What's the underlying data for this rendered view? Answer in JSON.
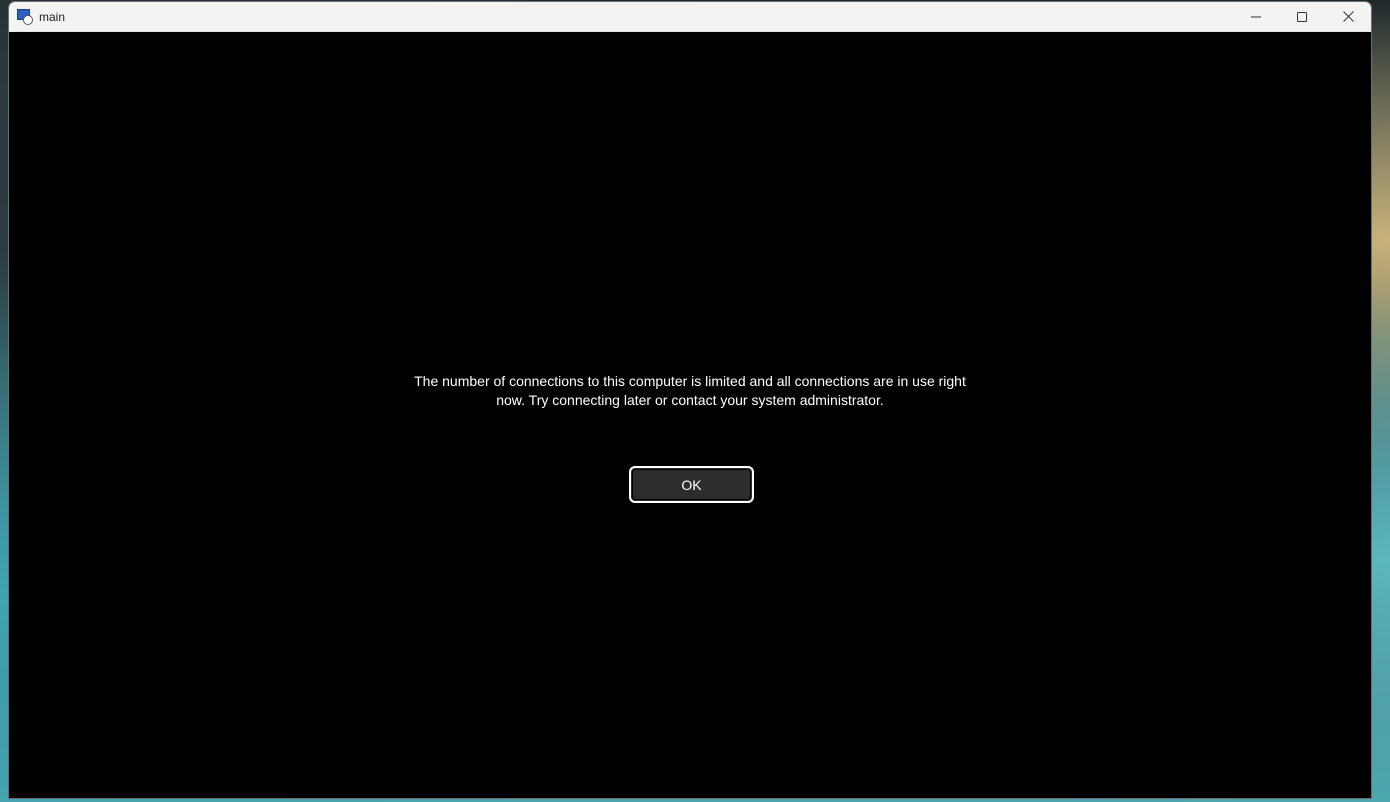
{
  "window": {
    "title": "main"
  },
  "caption": {
    "minimize_icon": "minimize-icon",
    "maximize_icon": "maximize-icon",
    "close_icon": "close-icon"
  },
  "dialog": {
    "message": "The number of connections to this computer is limited and all connections are in use right now. Try connecting later or contact your system administrator.",
    "ok_label": "OK"
  },
  "colors": {
    "content_background": "#000000",
    "titlebar_background": "#f3f3f3",
    "button_background": "#2d2d2d",
    "button_border": "#ffffff",
    "text": "#ffffff"
  }
}
